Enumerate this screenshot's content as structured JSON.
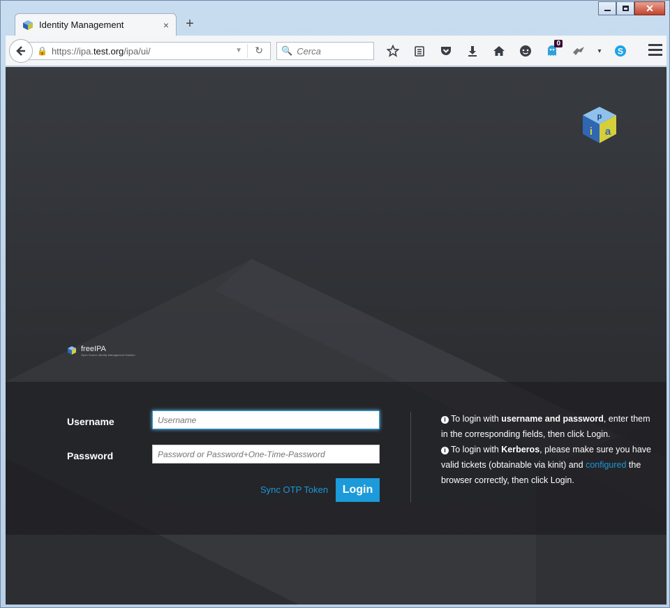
{
  "browser": {
    "tab_title": "Identity Management",
    "tab_close": "×",
    "new_tab": "+",
    "url_prefix": "https://ipa.",
    "url_domain": "test.org",
    "url_path": "/ipa/ui/",
    "search_placeholder": "Cerca",
    "notification_count": "0",
    "window_close": "✕"
  },
  "branding": {
    "logo_name": "freeIPA",
    "logo_tagline": "Open Source Identity Management Solution"
  },
  "login": {
    "username_label": "Username",
    "username_placeholder": "Username",
    "password_label": "Password",
    "password_placeholder": "Password or Password+One-Time-Password",
    "sync_otp_label": "Sync OTP Token",
    "login_button": "Login"
  },
  "help": {
    "line1_pre": "To login with ",
    "line1_bold": "username and password",
    "line1_post": ", enter them in the corresponding fields, then click Login.",
    "line2_pre": "To login with ",
    "line2_bold": "Kerberos",
    "line2_mid": ", please make sure you have valid tickets (obtainable via kinit) and ",
    "line2_link": "configured",
    "line2_post": " the browser correctly, then click Login."
  },
  "colors": {
    "accent": "#1c9ad9",
    "page_bg": "#2f3135"
  }
}
